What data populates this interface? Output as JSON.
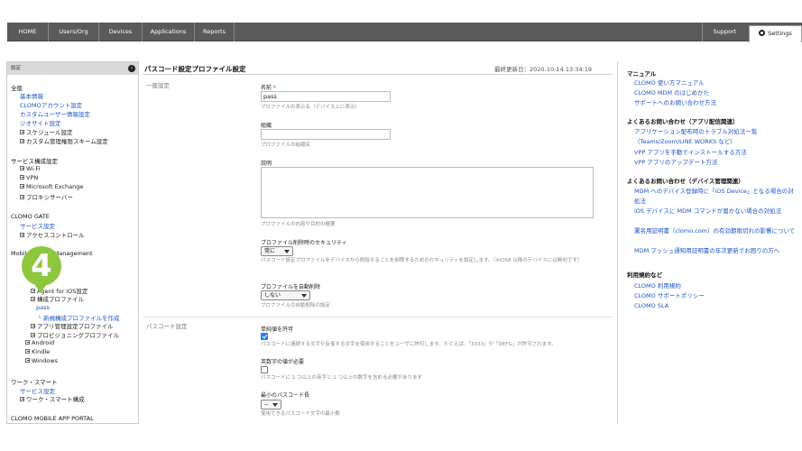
{
  "nav": {
    "tabs": [
      "HOME",
      "Users/Org",
      "Devices",
      "Applications",
      "Reports"
    ],
    "support": "Support",
    "settings": "Settings"
  },
  "sidebar": {
    "header": "設定",
    "sections": {
      "general": "全般",
      "service": "サービス構成設定",
      "gate": "CLOMO GATE",
      "mdm": "Mobile Device Management",
      "work": "ワーク・スマート",
      "portal": "CLOMO MOBILE APP PORTAL"
    },
    "general_links": [
      "基本情報",
      "CLOMOアカウント設定",
      "カスタムユーザー情報設定",
      "ジオサイト設定"
    ],
    "general_items": [
      "スケジュール設定",
      "カスタム管理権限スキーム設定"
    ],
    "service_items": [
      "Wi-Fi",
      "VPN",
      "Microsoft Exchange",
      "プロキシサーバー"
    ],
    "gate_link": "サービス設定",
    "gate_item": "アクセスコントロール",
    "mdm_agent": "Agent for iOS設定",
    "mdm_profile": "構成プロファイル",
    "mdm_pass": "pass",
    "mdm_new": "新規構成プロファイルを作成",
    "mdm_items": [
      "アプリ管理設定プロファイル",
      "プロビジョニングプロファイル",
      "Android",
      "Kindle",
      "Windows"
    ],
    "work_link": "サービス設定",
    "work_item": "ワーク・スマート構成"
  },
  "badge": "4",
  "main": {
    "title": "パスコード設定プロファイル設定",
    "updated": "最終更新日：2020-10-14 13:34:19",
    "general_label": "一般設定",
    "name_label": "名前",
    "required_mark": "*",
    "name_value": "pass",
    "name_help": "プロファイルの表示名（デバイス上に表示）",
    "org_label": "組織",
    "org_value": "",
    "org_help": "プロファイルの組織名",
    "desc_label": "説明",
    "desc_help": "プロファイルの内容や目的の概要",
    "security_label": "プロファイル削除時のセキュリティ",
    "security_value": "常に",
    "security_help": "パスコード設定プロファイルをデバイスから削除することを制限するためのセキュリティを設定します。（※iOS8 以降のデバイスには無効です）",
    "autodelete_label": "プロファイルを自動削除",
    "autodelete_value": "しない",
    "autodelete_help": "プロファイルの自動削除の設定",
    "passcode_label": "パスコード設定",
    "simple_label": "単純値を許可",
    "simple_help": "パスコードに連続する文字や反復する文字を使用することをユーザに許可します。たとえば、「3333」や「DEFG」が許可されます。",
    "alnum_label": "英数字の値が必要",
    "alnum_help": "パスコードに 1 つ以上の英字と 1 つ以上の数字を含める必要があります",
    "minlen_label": "最小のパスコード長",
    "minlen_value": "--",
    "minlen_help": "使用できるパスコード文字の最小数"
  },
  "right": {
    "manual_head": "マニュアル",
    "manual_links": [
      "CLOMO 使い方マニュアル",
      "CLOMO MDM のはじめかた",
      "サポートへのお問い合わせ方法"
    ],
    "faq_app_head": "よくあるお問い合わせ（アプリ配信関連）",
    "faq_app_links": [
      "アプリケーション配布時のトラブル対処法一覧（Teams/Zoom/LINE WORKS など）",
      "VPP アプリを手動でインストールする方法",
      "VPP アプリのアップデート方法"
    ],
    "faq_dev_head": "よくあるお問い合わせ（デバイス管理関連）",
    "faq_dev_links": [
      "MDM へのデバイス登録時に「iOS Device」となる場合の対処法",
      "iOS デバイスに MDM コマンドが届かない場合の対処法",
      "署名用証明書（clomo.com）の有効期限切れの影響について",
      "MDM プッシュ通知用証明書の年次更新でお困りの方へ"
    ],
    "terms_head": "利用規約など",
    "terms_links": [
      "CLOMO 利用規約",
      "CLOMO サポートポリシー",
      "CLOMO SLA"
    ]
  }
}
